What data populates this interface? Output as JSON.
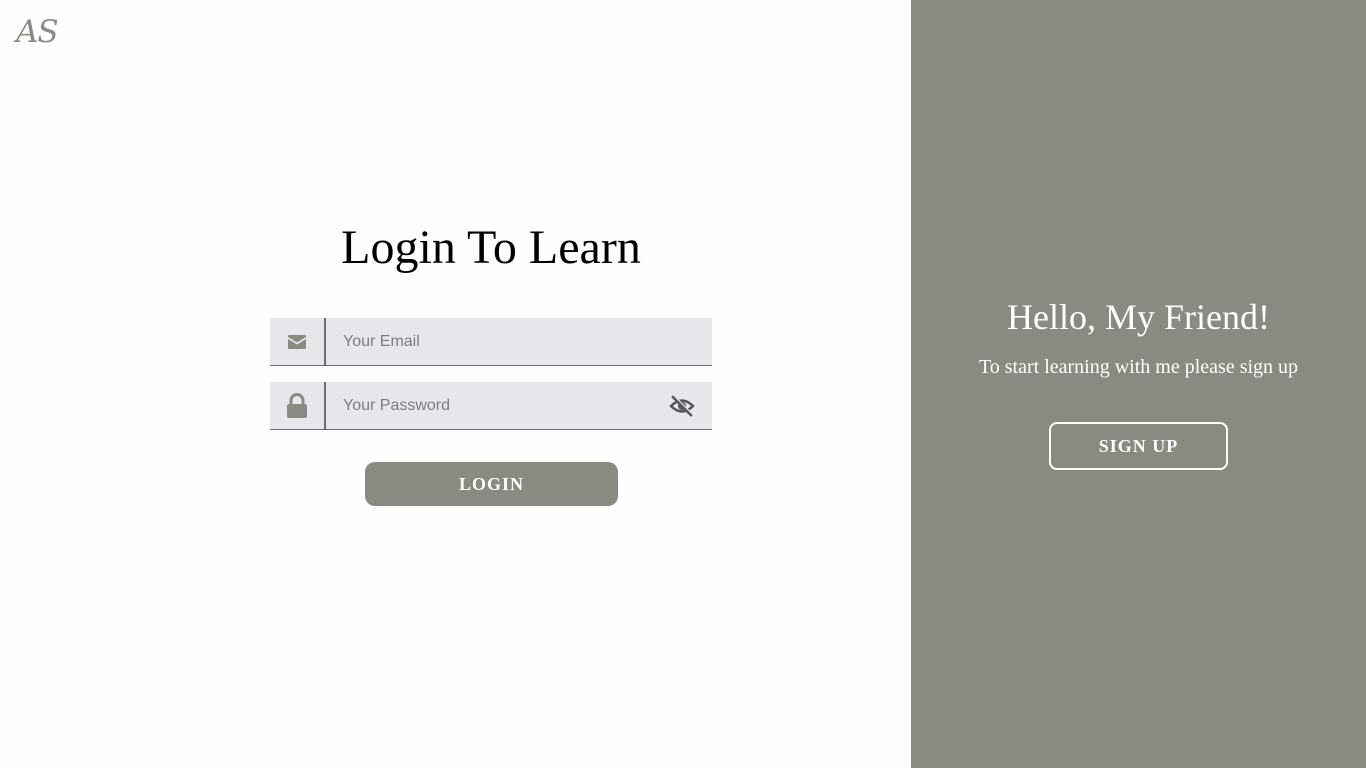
{
  "logo": {
    "text": "AS"
  },
  "login": {
    "title": "Login To Learn",
    "email_placeholder": "Your Email",
    "password_placeholder": "Your Password",
    "login_label": "LOGIN"
  },
  "signup_panel": {
    "heading": "Hello, My Friend!",
    "subtext": "To start learning with me please sign up",
    "signup_label": "SIGN UP"
  },
  "icons": {
    "email": "envelope-icon",
    "password": "lock-icon",
    "toggle_visibility": "eye-slash-icon"
  },
  "colors": {
    "accent": "#8b8a82",
    "field_bg": "#e6e7ea",
    "text_on_accent": "#ffffff"
  }
}
